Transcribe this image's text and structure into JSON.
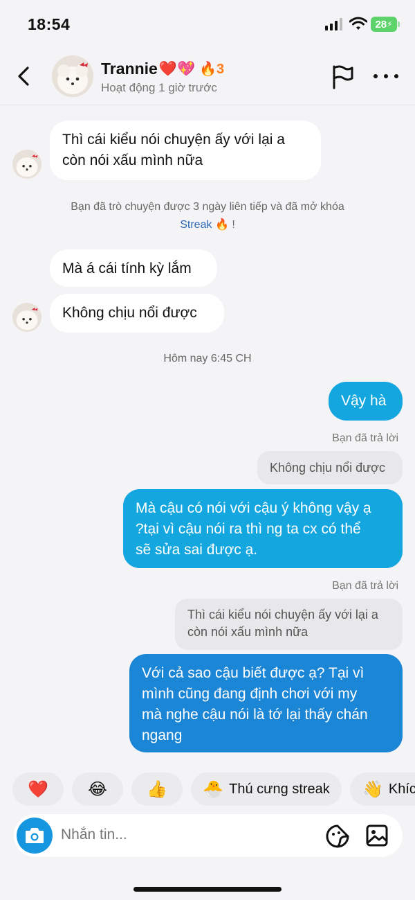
{
  "status_bar": {
    "time": "18:54",
    "battery": "28"
  },
  "header": {
    "contact_name": "Trannie",
    "name_emoji": "❤️💖",
    "streak_icon": "fire-icon",
    "streak_count": "3",
    "status": "Hoạt động 1 giờ trước"
  },
  "messages": [
    {
      "direction": "in",
      "lines": [
        "Thì cái kiểu nói chuyện ấy với lại a",
        "còn nói xấu mình nữa"
      ]
    },
    {
      "direction": "in",
      "lines": [
        "Mà á cái tính kỳ lắm"
      ]
    },
    {
      "direction": "in",
      "lines": [
        "Không chịu nổi được"
      ]
    },
    {
      "direction": "out",
      "lines": [
        "Vậy hà"
      ]
    },
    {
      "direction": "out",
      "reply_label": "Bạn đã trả lời",
      "quoted": [
        "Không chịu nổi được"
      ],
      "lines": [
        "Mà cậu có nói với cậu ý không vậy ạ",
        "?tại vì cậu nói ra thì ng ta cx có thể",
        "sẽ sửa sai được ạ."
      ]
    },
    {
      "direction": "out",
      "reply_label": "Bạn đã trả lời",
      "quoted": [
        "Thì cái kiểu nói chuyện ấy với lại a",
        "còn nói xấu mình nữa"
      ],
      "lines": [
        "Với cả sao cậu biết được ạ? Tại vì",
        "mình cũng đang định chơi với my",
        "mà nghe cậu nói là tớ lại thấy chán",
        "ngang"
      ]
    }
  ],
  "system": {
    "streak_notice": "Bạn đã trò chuyện được 3 ngày liên tiếp và đã mở khóa",
    "streak_link": "Streak",
    "streak_suffix": "!",
    "timestamp": "Hôm nay 6:45 CH"
  },
  "reactions": [
    {
      "emoji": "❤️",
      "icon": "heart-icon"
    },
    {
      "emoji": "😂",
      "icon": "laughing-face-icon"
    },
    {
      "emoji": "👍",
      "icon": "thumbs-up-icon"
    },
    {
      "emoji": "🐣",
      "icon": "streak-pet-icon",
      "label": "Thú cưng streak"
    },
    {
      "emoji": "👋",
      "icon": "waving-hand-icon",
      "label": "Khíc"
    }
  ],
  "composer": {
    "placeholder": "Nhắn tin..."
  },
  "colors": {
    "outgoing_bubble": "#13a6df",
    "outgoing_bubble_latest": "#1c86d6",
    "incoming_bubble": "#ffffff",
    "streak_link": "#2b66b5"
  }
}
